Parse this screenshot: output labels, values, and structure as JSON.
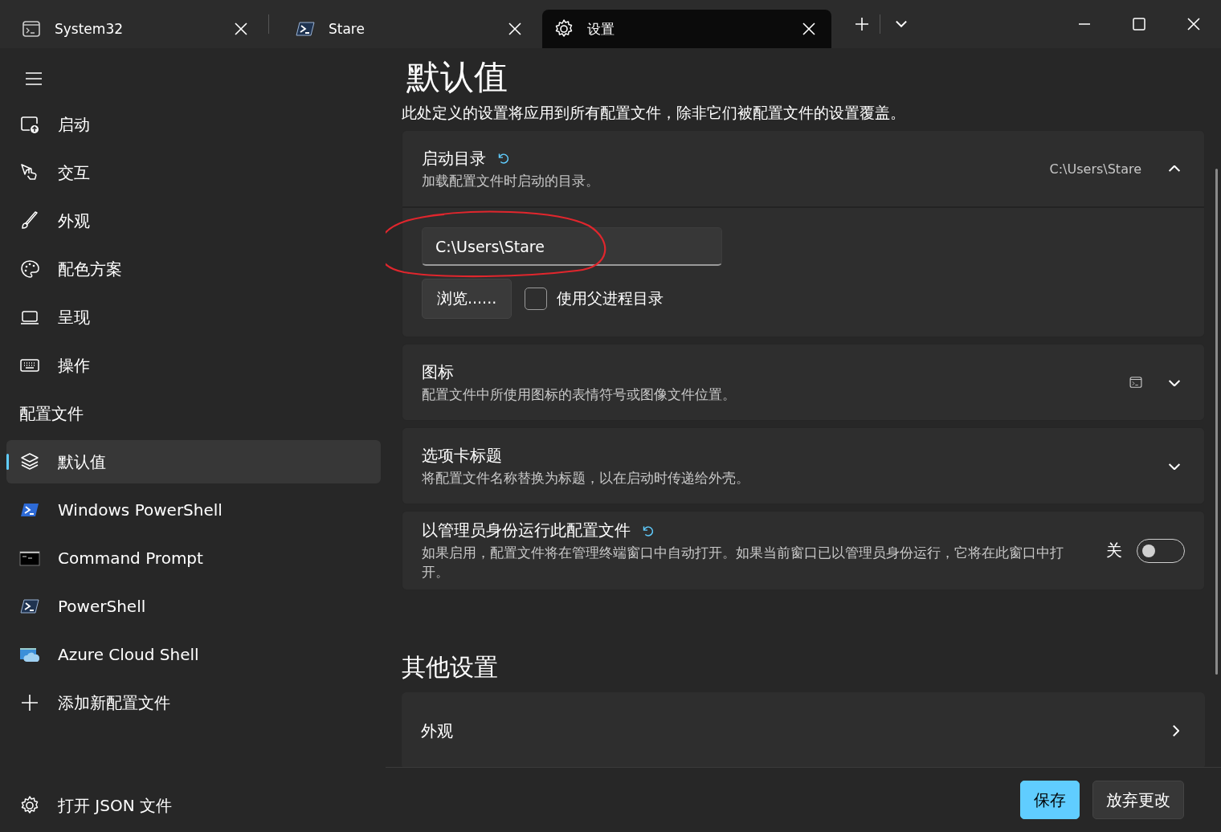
{
  "tabs": [
    {
      "title": "System32",
      "selected": false
    },
    {
      "title": "Stare",
      "selected": false
    },
    {
      "title": "设置",
      "selected": true
    }
  ],
  "sidebar": {
    "items": [
      {
        "kind": "nav",
        "label": "启动",
        "selected": false
      },
      {
        "kind": "nav",
        "label": "交互",
        "selected": false
      },
      {
        "kind": "nav",
        "label": "外观",
        "selected": false
      },
      {
        "kind": "nav",
        "label": "配色方案",
        "selected": false
      },
      {
        "kind": "nav",
        "label": "呈现",
        "selected": false
      },
      {
        "kind": "nav",
        "label": "操作",
        "selected": false
      },
      {
        "kind": "header",
        "label": "配置文件"
      },
      {
        "kind": "nav",
        "label": "默认值",
        "selected": true
      },
      {
        "kind": "nav",
        "label": "Windows PowerShell",
        "selected": false
      },
      {
        "kind": "nav",
        "label": "Command Prompt",
        "selected": false
      },
      {
        "kind": "nav",
        "label": "PowerShell",
        "selected": false
      },
      {
        "kind": "nav",
        "label": "Azure Cloud Shell",
        "selected": false
      },
      {
        "kind": "nav",
        "label": "添加新配置文件",
        "selected": false
      }
    ],
    "footer_item": {
      "label": "打开 JSON 文件"
    }
  },
  "main": {
    "title": "默认值",
    "description": "此处定义的设置将应用到所有配置文件，除非它们被配置文件的设置覆盖。",
    "settings": [
      {
        "kind": "expander",
        "title": "启动目录",
        "reset": true,
        "description": "加载配置文件时启动的目录。",
        "value": "C:\\Users\\Stare",
        "expanded": true,
        "field_value": "C:\\Users\\Stare",
        "circled": true,
        "browse_label": "浏览......",
        "checkbox_label": "使用父进程目录",
        "checked": false
      },
      {
        "kind": "expander",
        "title": "图标",
        "reset": false,
        "description": "配置文件中所使用图标的表情符号或图像文件位置。",
        "expanded": false
      },
      {
        "kind": "expander",
        "title": "选项卡标题",
        "reset": false,
        "description": "将配置文件名称替换为标题，以在启动时传递给外壳。",
        "expanded": false
      },
      {
        "kind": "toggle",
        "title": "以管理员身份运行此配置文件",
        "reset": true,
        "description": "如果启用，配置文件将在管理终端窗口中自动打开。如果当前窗口已以管理员身份运行，它将在此窗口中打开。",
        "toggle_label": "关",
        "on": false
      }
    ],
    "section_title": "其他设置",
    "links": [
      {
        "title": "外观"
      }
    ]
  },
  "buttons": [
    {
      "label": "保存",
      "primary": true
    },
    {
      "label": "放弃更改",
      "primary": false
    }
  ]
}
